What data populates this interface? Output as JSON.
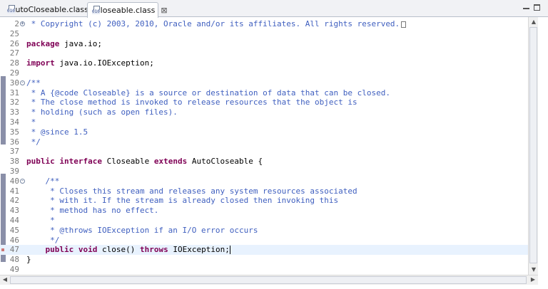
{
  "tabs": [
    {
      "label": "AutoCloseable.class"
    },
    {
      "label": "Closeable.class",
      "close_symbol": "⊠"
    }
  ],
  "editor": {
    "caret_line": 47,
    "lines": [
      {
        "n": "2",
        "fold": "+",
        "parts": [
          {
            "t": " * Copyright (c) 2003, 2010, Oracle and/or its affiliates. All rights reserved.",
            "c": "cm"
          }
        ],
        "box": true
      },
      {
        "n": "25",
        "parts": []
      },
      {
        "n": "26",
        "parts": [
          {
            "t": "package",
            "c": "kw"
          },
          {
            "t": " java.io;"
          }
        ]
      },
      {
        "n": "27",
        "parts": []
      },
      {
        "n": "28",
        "parts": [
          {
            "t": "import",
            "c": "kw"
          },
          {
            "t": " java.io.IOException;"
          }
        ]
      },
      {
        "n": "29",
        "parts": []
      },
      {
        "n": "30",
        "fold": "-",
        "parts": [
          {
            "t": "/**",
            "c": "cm"
          }
        ]
      },
      {
        "n": "31",
        "parts": [
          {
            "t": " * A {@code Closeable} is a source or destination of data that can be closed.",
            "c": "cm"
          }
        ]
      },
      {
        "n": "32",
        "parts": [
          {
            "t": " * The close method is invoked to release resources that the object is",
            "c": "cm"
          }
        ]
      },
      {
        "n": "33",
        "parts": [
          {
            "t": " * holding (such as open files).",
            "c": "cm"
          }
        ]
      },
      {
        "n": "34",
        "parts": [
          {
            "t": " *",
            "c": "cm"
          }
        ]
      },
      {
        "n": "35",
        "parts": [
          {
            "t": " * @since 1.5",
            "c": "cm"
          }
        ]
      },
      {
        "n": "36",
        "parts": [
          {
            "t": " */",
            "c": "cm"
          }
        ]
      },
      {
        "n": "37",
        "parts": []
      },
      {
        "n": "38",
        "parts": [
          {
            "t": "public",
            "c": "kw"
          },
          {
            "t": " "
          },
          {
            "t": "interface",
            "c": "kw"
          },
          {
            "t": " Closeable "
          },
          {
            "t": "extends",
            "c": "kw"
          },
          {
            "t": " AutoCloseable {"
          }
        ]
      },
      {
        "n": "39",
        "parts": []
      },
      {
        "n": "40",
        "fold": "-",
        "parts": [
          {
            "t": "    /**",
            "c": "cm"
          }
        ]
      },
      {
        "n": "41",
        "parts": [
          {
            "t": "     * Closes this stream and releases any system resources associated",
            "c": "cm"
          }
        ]
      },
      {
        "n": "42",
        "parts": [
          {
            "t": "     * with it. If the stream is already closed then invoking this",
            "c": "cm"
          }
        ]
      },
      {
        "n": "43",
        "parts": [
          {
            "t": "     * method has no effect.",
            "c": "cm"
          }
        ]
      },
      {
        "n": "44",
        "parts": [
          {
            "t": "     *",
            "c": "cm"
          }
        ]
      },
      {
        "n": "45",
        "parts": [
          {
            "t": "     * @throws IOException if an I/O error occurs",
            "c": "cm"
          }
        ]
      },
      {
        "n": "46",
        "parts": [
          {
            "t": "     */",
            "c": "cm"
          }
        ]
      },
      {
        "n": "47",
        "parts": [
          {
            "t": "    "
          },
          {
            "t": "public",
            "c": "kw"
          },
          {
            "t": " "
          },
          {
            "t": "void",
            "c": "kw"
          },
          {
            "t": " close() "
          },
          {
            "t": "throws",
            "c": "kw"
          },
          {
            "t": " IOException;"
          }
        ],
        "caret": true
      },
      {
        "n": "48",
        "parts": [
          {
            "t": "}"
          }
        ]
      },
      {
        "n": "49",
        "parts": []
      }
    ]
  },
  "scrollbars": {
    "up": "▲",
    "down": "▼",
    "left": "◀",
    "right": "▶"
  },
  "colors": {
    "keyword": "#7f0055",
    "comment": "#3f5fbf",
    "current_line": "#e8f2fe"
  }
}
